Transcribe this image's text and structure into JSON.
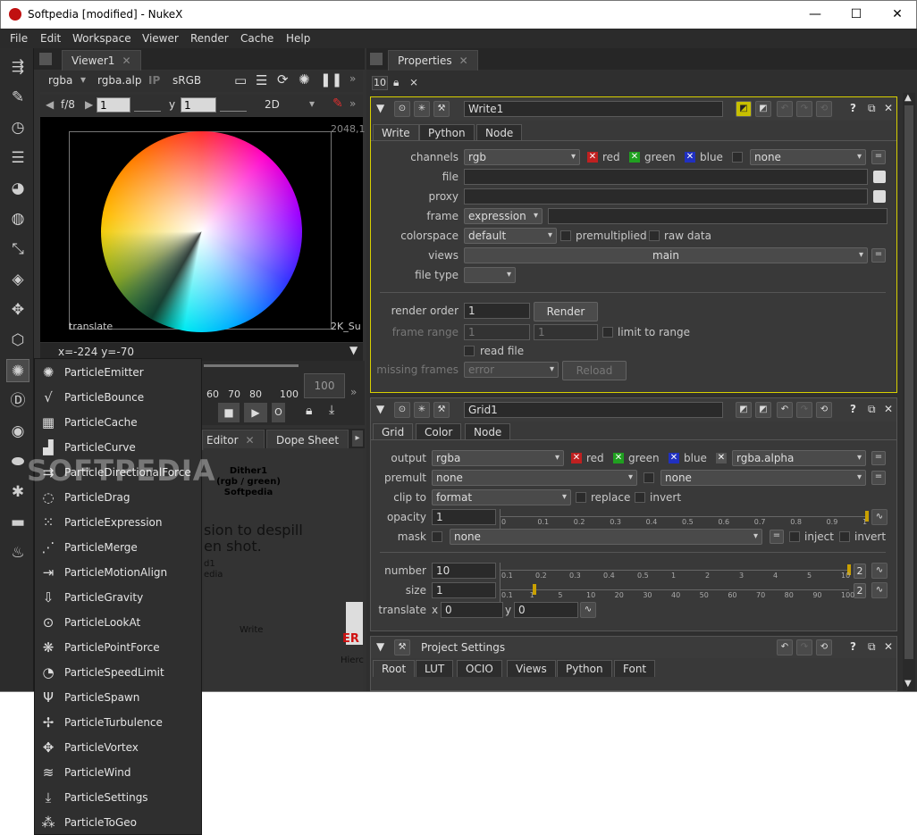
{
  "window": {
    "title": "Softpedia [modified] - NukeX",
    "minimize": "—",
    "maximize": "☐",
    "close": "✕"
  },
  "menu": [
    "File",
    "Edit",
    "Workspace",
    "Viewer",
    "Render",
    "Cache",
    "Help"
  ],
  "viewer": {
    "tab": "Viewer1",
    "tab_close": "✕",
    "channels": "rgba",
    "alpha_channel": "rgba.alp",
    "ip": "IP",
    "colorspace": "sRGB",
    "fstop": "f/8",
    "gain": "1",
    "y_label": "y",
    "gamma": "1",
    "mode": "2D",
    "res_label_top": "2048,1",
    "res_label_bottom": "2K_Su",
    "corner_label": "translate",
    "coords": "x=-224 y=-70",
    "timeline_ticks": [
      "60",
      "70",
      "80",
      "100"
    ],
    "frame_end": "100"
  },
  "bottom_tabs": {
    "editor": "Editor",
    "dope": "Dope Sheet"
  },
  "graph": {
    "node1": "Dither1",
    "node1_sub": "(rgb / green)",
    "node1_sub2": "Softpedia",
    "text1": "sion to despill",
    "text2": "en shot.",
    "text3": "d1",
    "text4": "edia",
    "write": "Write",
    "er": "ER",
    "hier": "Hierc"
  },
  "properties": {
    "tab": "Properties",
    "tab_close": "✕",
    "max_panels": "10",
    "write": {
      "name": "Write1",
      "help": "?",
      "tabs": [
        "Write",
        "Python",
        "Node"
      ],
      "channels_label": "channels",
      "channels": "rgb",
      "red": "red",
      "green": "green",
      "blue": "blue",
      "none": "none",
      "file_label": "file",
      "proxy_label": "proxy",
      "frame_label": "frame",
      "frame": "expression",
      "colorspace_label": "colorspace",
      "colorspace": "default",
      "premultiplied": "premultiplied",
      "raw_data": "raw data",
      "views_label": "views",
      "views": "main",
      "filetype_label": "file type",
      "render_order_label": "render order",
      "render_order": "1",
      "render_btn": "Render",
      "frame_range_label": "frame range",
      "frame_range_a": "1",
      "frame_range_b": "1",
      "limit": "limit to range",
      "read_file": "read file",
      "missing_label": "missing frames",
      "missing": "error",
      "reload": "Reload"
    },
    "grid": {
      "name": "Grid1",
      "help": "?",
      "tabs": [
        "Grid",
        "Color",
        "Node"
      ],
      "output_label": "output",
      "output": "rgba",
      "red": "red",
      "green": "green",
      "blue": "blue",
      "alpha": "rgba.alpha",
      "premult_label": "premult",
      "premult": "none",
      "premult2": "none",
      "clip_label": "clip to",
      "clip": "format",
      "replace": "replace",
      "invert": "invert",
      "opacity_label": "opacity",
      "opacity": "1",
      "opacity_ticks": [
        "0",
        "0.1",
        "0.2",
        "0.3",
        "0.4",
        "0.5",
        "0.6",
        "0.7",
        "0.8",
        "0.9",
        "1"
      ],
      "mask_label": "mask",
      "mask": "none",
      "inject": "inject",
      "mask_invert": "invert",
      "number_label": "number",
      "number": "10",
      "number_ticks": [
        "0.1",
        "0.2",
        "0.3",
        "0.4",
        "0.5",
        "1",
        "2",
        "3",
        "4",
        "5",
        "10"
      ],
      "size_label": "size",
      "size": "1",
      "size_ticks": [
        "0.1",
        "1",
        "5",
        "10",
        "20",
        "30",
        "40",
        "50",
        "60",
        "70",
        "80",
        "90",
        "100"
      ],
      "translate_label": "translate",
      "tx_label": "x",
      "tx": "0",
      "ty_label": "y",
      "ty": "0",
      "two": "2"
    },
    "project": {
      "name": "Project Settings",
      "help": "?",
      "tabs": [
        "Root",
        "LUT",
        "OCIO",
        "Views",
        "Python",
        "Font"
      ]
    }
  },
  "particle_menu": [
    {
      "label": "ParticleEmitter",
      "icon": "particle-emitter-icon",
      "glyph": "✺"
    },
    {
      "label": "ParticleBounce",
      "icon": "particle-bounce-icon",
      "glyph": "√"
    },
    {
      "label": "ParticleCache",
      "icon": "particle-cache-icon",
      "glyph": "▦"
    },
    {
      "label": "ParticleCurve",
      "icon": "particle-curve-icon",
      "glyph": "▟"
    },
    {
      "label": "ParticleDirectionalForce",
      "icon": "particle-directional-force-icon",
      "glyph": "⇉"
    },
    {
      "label": "ParticleDrag",
      "icon": "particle-drag-icon",
      "glyph": "◌"
    },
    {
      "label": "ParticleExpression",
      "icon": "particle-expression-icon",
      "glyph": "⁙"
    },
    {
      "label": "ParticleMerge",
      "icon": "particle-merge-icon",
      "glyph": "⋰"
    },
    {
      "label": "ParticleMotionAlign",
      "icon": "particle-motion-align-icon",
      "glyph": "⇥"
    },
    {
      "label": "ParticleGravity",
      "icon": "particle-gravity-icon",
      "glyph": "⇩"
    },
    {
      "label": "ParticleLookAt",
      "icon": "particle-look-at-icon",
      "glyph": "⊙"
    },
    {
      "label": "ParticlePointForce",
      "icon": "particle-point-force-icon",
      "glyph": "❋"
    },
    {
      "label": "ParticleSpeedLimit",
      "icon": "particle-speed-limit-icon",
      "glyph": "◔"
    },
    {
      "label": "ParticleSpawn",
      "icon": "particle-spawn-icon",
      "glyph": "Ψ"
    },
    {
      "label": "ParticleTurbulence",
      "icon": "particle-turbulence-icon",
      "glyph": "✢"
    },
    {
      "label": "ParticleVortex",
      "icon": "particle-vortex-icon",
      "glyph": "✥"
    },
    {
      "label": "ParticleWind",
      "icon": "particle-wind-icon",
      "glyph": "≋"
    },
    {
      "label": "ParticleSettings",
      "icon": "particle-settings-icon",
      "glyph": "⤓"
    },
    {
      "label": "ParticleToGeo",
      "icon": "particle-to-geo-icon",
      "glyph": "⁂"
    }
  ],
  "toolbar_icons": [
    {
      "name": "image-icon",
      "glyph": "⇶"
    },
    {
      "name": "draw-icon",
      "glyph": "✎"
    },
    {
      "name": "time-icon",
      "glyph": "◷"
    },
    {
      "name": "channel-icon",
      "glyph": "☰"
    },
    {
      "name": "color-icon",
      "glyph": "◕"
    },
    {
      "name": "filter-icon",
      "glyph": "◍"
    },
    {
      "name": "keyer-icon",
      "glyph": "⤡"
    },
    {
      "name": "merge-icon",
      "glyph": "◈"
    },
    {
      "name": "transform-icon",
      "glyph": "✥"
    },
    {
      "name": "3d-icon",
      "glyph": "⬡"
    },
    {
      "name": "particles-icon",
      "glyph": "✺"
    },
    {
      "name": "deep-icon",
      "glyph": "Ⓓ"
    },
    {
      "name": "views-icon",
      "glyph": "◉"
    },
    {
      "name": "metadata-icon",
      "glyph": "⬬"
    },
    {
      "name": "other-icon",
      "glyph": "✱"
    },
    {
      "name": "furnace-icon",
      "glyph": "▬"
    },
    {
      "name": "furnace-core-icon",
      "glyph": "♨"
    }
  ]
}
